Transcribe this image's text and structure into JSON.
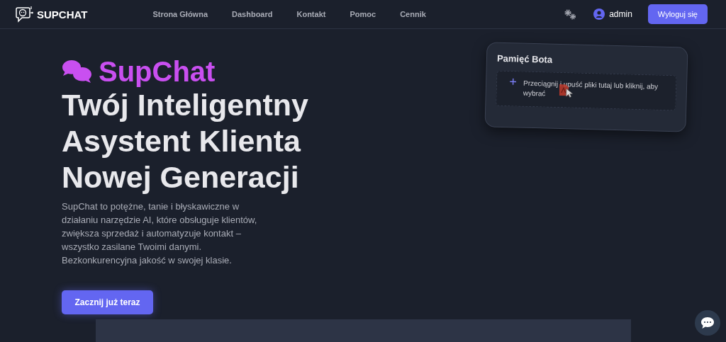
{
  "header": {
    "brand": "SUPCHAT",
    "nav": [
      {
        "label": "Strona Główna"
      },
      {
        "label": "Dashboard"
      },
      {
        "label": "Kontakt"
      },
      {
        "label": "Pomoc"
      },
      {
        "label": "Cennik"
      }
    ],
    "user": "admin",
    "logout": "Wyloguj się"
  },
  "hero": {
    "brand": "SupChat",
    "title_lines": [
      "Twój Inteligentny",
      "Asystent Klienta",
      "Nowej Generacji"
    ],
    "description": "SupChat to potężne, tanie i błyskawiczne w działaniu narzędzie AI, które obsługuje klientów, zwiększa sprzedaż i automatyzuje kontakt – wszystko zasilane Twoimi danymi. Bezkonkurencyjna jakość w swojej klasie.",
    "cta": "Zacznij już teraz"
  },
  "memory_card": {
    "title": "Pamięć Bota",
    "dropzone": "Przeciągnij i upuść pliki tutaj lub kliknij, aby wybrać"
  }
}
